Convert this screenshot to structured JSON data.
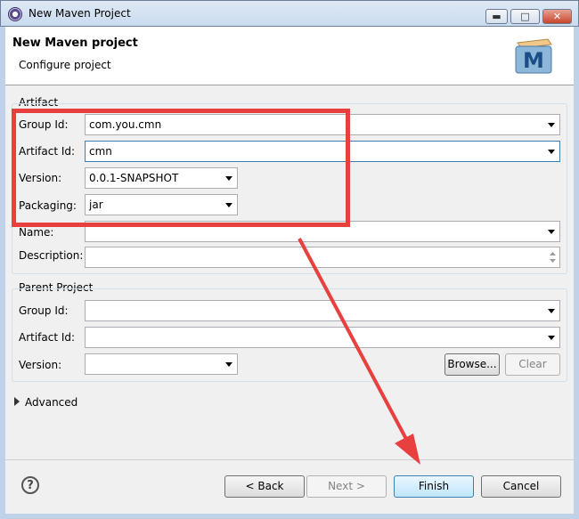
{
  "window": {
    "title": "New Maven Project",
    "min_glyph": "▬",
    "max_glyph": "□",
    "close_glyph": "✕"
  },
  "header": {
    "title": "New Maven project",
    "subtitle": "Configure project",
    "logo_letter": "M"
  },
  "artifact": {
    "section": "Artifact",
    "group_id_label": "Group Id:",
    "group_id_value": "com.you.cmn",
    "artifact_id_label": "Artifact Id:",
    "artifact_id_value": "cmn",
    "version_label": "Version:",
    "version_value": "0.0.1-SNAPSHOT",
    "packaging_label": "Packaging:",
    "packaging_value": "jar",
    "name_label": "Name:",
    "name_value": "",
    "description_label": "Description:",
    "description_value": ""
  },
  "parent": {
    "section": "Parent Project",
    "group_id_label": "Group Id:",
    "group_id_value": "",
    "artifact_id_label": "Artifact Id:",
    "artifact_id_value": "",
    "version_label": "Version:",
    "version_value": "",
    "browse_label": "Browse...",
    "clear_label": "Clear"
  },
  "advanced": {
    "label": "Advanced"
  },
  "footer": {
    "help_glyph": "?",
    "back_label": "< Back",
    "next_label": "Next >",
    "finish_label": "Finish",
    "cancel_label": "Cancel"
  },
  "colors": {
    "highlight": "#e8403f",
    "arrow": "#e8403f"
  }
}
